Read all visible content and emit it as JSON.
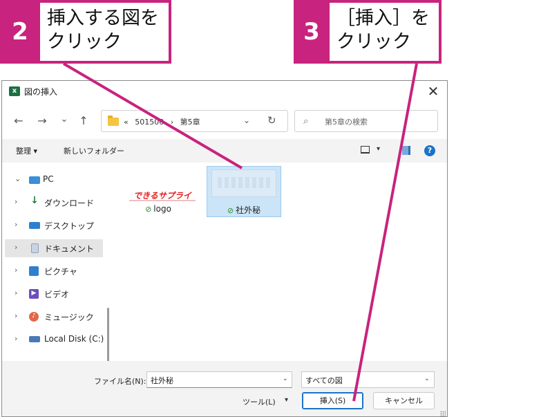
{
  "callouts": {
    "step2": {
      "number": "2",
      "line1": "挿入する図を",
      "line2": "クリック"
    },
    "step3": {
      "number": "3",
      "line1": "［挿入］を",
      "line2": "クリック"
    }
  },
  "dialog": {
    "title": "図の挿入",
    "app_icon": "x",
    "close_glyph": "✕",
    "nav": {
      "back": "←",
      "forward": "→",
      "recent": "⌄",
      "up": "↑"
    },
    "address": {
      "breadcrumbs": [
        "«",
        "501500",
        "›",
        "第5章"
      ],
      "dropdown": "⌄",
      "refresh": "↻"
    },
    "search": {
      "placeholder": "第5章の検索"
    },
    "toolbar": {
      "organize": "整理 ▾",
      "new_folder": "新しいフォルダー",
      "view_dropdown": "▾",
      "help": "?"
    },
    "sidebar": {
      "items": [
        {
          "chevron": "⌄",
          "label": "PC",
          "icon": "pc-icon"
        },
        {
          "chevron": "›",
          "label": "ダウンロード",
          "icon": "download-icon"
        },
        {
          "chevron": "›",
          "label": "デスクトップ",
          "icon": "desktop-icon"
        },
        {
          "chevron": "›",
          "label": "ドキュメント",
          "icon": "document-icon"
        },
        {
          "chevron": "›",
          "label": "ピクチャ",
          "icon": "pictures-icon"
        },
        {
          "chevron": "›",
          "label": "ビデオ",
          "icon": "video-icon"
        },
        {
          "chevron": "›",
          "label": "ミュージック",
          "icon": "music-icon"
        },
        {
          "chevron": "›",
          "label": "Local Disk (C:)",
          "icon": "disk-icon"
        }
      ],
      "selected_index": 3
    },
    "files": [
      {
        "name": "logo",
        "thumb_text": "できるサプライ",
        "status": "⊘"
      },
      {
        "name": "社外秘",
        "status": "⊘"
      }
    ],
    "footer": {
      "filename_label": "ファイル名(N):",
      "filename_value": "社外秘",
      "filetype_value": "すべての図",
      "tools_label": "ツール(L)",
      "insert_label": "挿入(S)",
      "cancel_label": "キャンセル",
      "dropdown": "⌄"
    }
  },
  "colors": {
    "accent": "#c8237e",
    "selection": "#cce4f7",
    "primary_button_border": "#1a73c8"
  }
}
